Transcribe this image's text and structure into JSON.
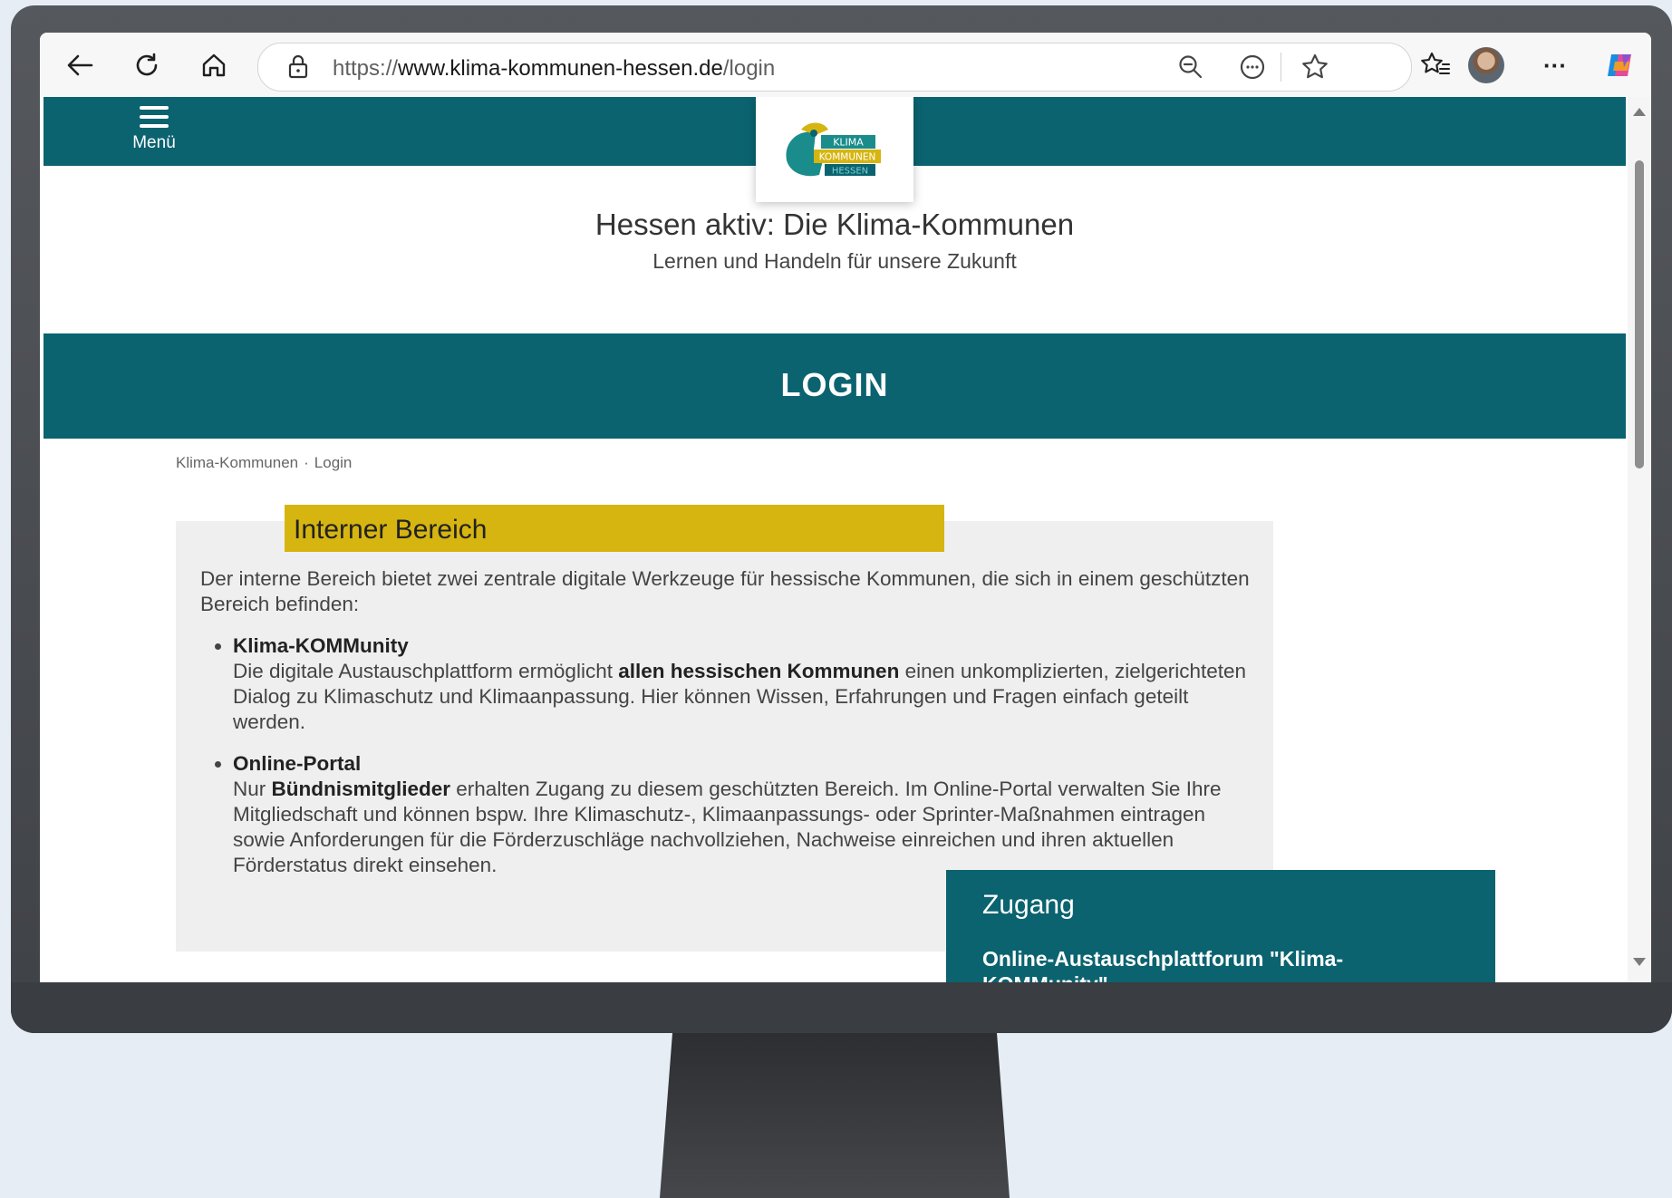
{
  "browser": {
    "url_scheme": "https://",
    "url_domain": "www.klima-kommunen-hessen.de",
    "url_path": "/login",
    "more_label": "···"
  },
  "site": {
    "menu_label": "Menü",
    "logo_words": [
      "KLIMA",
      "KOMMUNEN",
      "HESSEN"
    ],
    "title": "Hessen aktiv: Die Klima-Kommunen",
    "subtitle": "Lernen und Handeln für unsere Zukunft",
    "page_heading": "LOGIN"
  },
  "breadcrumb": {
    "items": [
      "Klima-Kommunen",
      "Login"
    ],
    "separator": "·"
  },
  "internal": {
    "heading": "Interner Bereich",
    "intro": "Der interne Bereich bietet zwei zentrale digitale Werkzeuge für hessische Kommunen, die sich in einem geschützten Bereich befinden:",
    "items": [
      {
        "title": "Klima-KOMMunity",
        "text_before": "Die digitale Austauschplattform ermöglicht ",
        "bold": "allen hessischen Kommunen",
        "text_after": " einen unkomplizierten, zielgerichteten Dialog zu Klimaschutz und Klimaanpassung. Hier können Wissen, Erfahrungen und Fragen einfach geteilt werden."
      },
      {
        "title": "Online-Portal",
        "text_before": "Nur ",
        "bold": "Bündnismitglieder",
        "text_after": " erhalten Zugang zu diesem geschützten Bereich. Im Online-Portal verwalten Sie Ihre Mitgliedschaft und können bspw. Ihre Klimaschutz-, Klimaanpassungs- oder Sprinter-Maßnahmen eintragen sowie Anforderungen für die Förderzuschläge nachvollziehen, Nachweise einreichen und ihren aktuellen Förderstatus direkt einsehen."
      }
    ]
  },
  "access": {
    "heading": "Zugang",
    "link": "Online-Austauschplattforum \"Klima-KOMMunity\""
  },
  "colors": {
    "brand_teal": "#0b6370",
    "accent_yellow": "#d6b511",
    "panel_gray": "#efefef"
  }
}
